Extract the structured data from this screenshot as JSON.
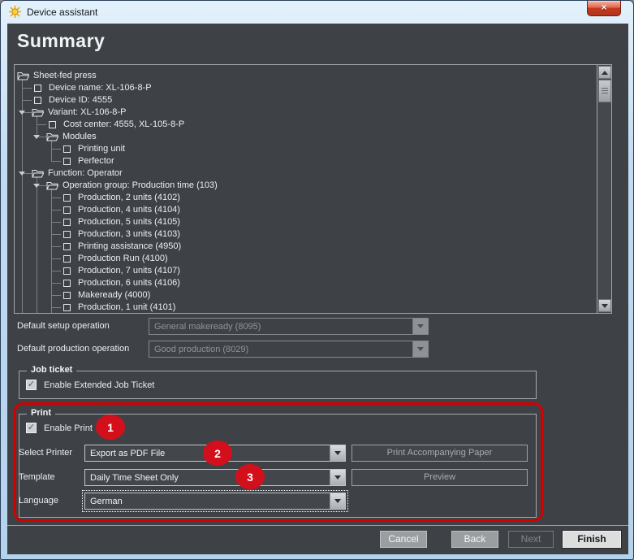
{
  "window": {
    "title": "Device assistant",
    "close_glyph": "×"
  },
  "heading": "Summary",
  "tree": {
    "items": [
      {
        "label": "Sheet-fed press",
        "level": 0,
        "icon": "folder",
        "arrow": false
      },
      {
        "label": "Device name: XL-106-8-P",
        "level": 1,
        "icon": "checkbox",
        "arrow": false
      },
      {
        "label": "Device ID: 4555",
        "level": 1,
        "icon": "checkbox",
        "arrow": false
      },
      {
        "label": "Variant: XL-106-8-P",
        "level": 1,
        "icon": "folder",
        "arrow": true
      },
      {
        "label": "Cost center: 4555, XL-105-8-P",
        "level": 2,
        "icon": "checkbox",
        "arrow": false
      },
      {
        "label": "Modules",
        "level": 2,
        "icon": "folder",
        "arrow": true
      },
      {
        "label": "Printing unit",
        "level": 3,
        "icon": "checkbox",
        "arrow": false
      },
      {
        "label": "Perfector",
        "level": 3,
        "icon": "checkbox",
        "arrow": false
      },
      {
        "label": "Function: Operator",
        "level": 1,
        "icon": "folder",
        "arrow": true
      },
      {
        "label": "Operation group: Production time (103)",
        "level": 2,
        "icon": "folder",
        "arrow": true
      },
      {
        "label": "Production, 2 units (4102)",
        "level": 3,
        "icon": "checkbox",
        "arrow": false
      },
      {
        "label": "Production, 4 units (4104)",
        "level": 3,
        "icon": "checkbox",
        "arrow": false
      },
      {
        "label": "Production, 5 units (4105)",
        "level": 3,
        "icon": "checkbox",
        "arrow": false
      },
      {
        "label": "Production, 3 units (4103)",
        "level": 3,
        "icon": "checkbox",
        "arrow": false
      },
      {
        "label": "Printing assistance (4950)",
        "level": 3,
        "icon": "checkbox",
        "arrow": false
      },
      {
        "label": "Production Run (4100)",
        "level": 3,
        "icon": "checkbox",
        "arrow": false
      },
      {
        "label": "Production, 7 units (4107)",
        "level": 3,
        "icon": "checkbox",
        "arrow": false
      },
      {
        "label": "Production, 6 units (4106)",
        "level": 3,
        "icon": "checkbox",
        "arrow": false
      },
      {
        "label": "Makeready (4000)",
        "level": 3,
        "icon": "checkbox",
        "arrow": false
      },
      {
        "label": "Production, 1 unit (4101)",
        "level": 3,
        "icon": "checkbox",
        "arrow": false
      },
      {
        "label": "",
        "level": 3,
        "icon": "checkbox",
        "arrow": false
      }
    ]
  },
  "fields": {
    "default_setup": {
      "label": "Default setup operation",
      "value": "General makeready (8095)",
      "disabled": true
    },
    "default_production": {
      "label": "Default production operation",
      "value": "Good production (8029)",
      "disabled": true
    }
  },
  "job_ticket": {
    "title": "Job ticket",
    "checkbox_label": "Enable Extended Job Ticket",
    "checked": true,
    "check_glyph": "✓"
  },
  "print": {
    "title": "Print",
    "enable_label": "Enable Print",
    "enable_checked": true,
    "check_glyph": "✓",
    "badge1": "1",
    "badge2": "2",
    "badge3": "3",
    "select_printer": {
      "label": "Select Printer",
      "value": "Export as PDF File"
    },
    "template": {
      "label": "Template",
      "value": "Daily Time Sheet Only"
    },
    "language": {
      "label": "Language",
      "value": "German"
    },
    "accompanying_button": "Print Accompanying Paper",
    "preview_button": "Preview"
  },
  "footer": {
    "cancel": "Cancel",
    "back": "Back",
    "next": "Next",
    "finish": "Finish"
  },
  "colors": {
    "accent_red": "#d40000",
    "badge_red": "#d40f1c",
    "content_bg": "#3e4247",
    "titlebar_blue": "#c2dbf1"
  }
}
